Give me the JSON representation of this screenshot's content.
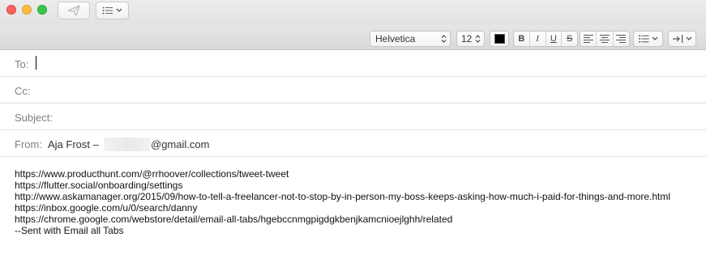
{
  "window": {
    "send_icon": "paper-plane-icon",
    "list_icon": "list-icon"
  },
  "format": {
    "font_name": "Helvetica",
    "font_size": "12",
    "text_color": "#000000",
    "bold": "B",
    "italic": "I",
    "underline": "U",
    "strikethrough": "S"
  },
  "header": {
    "to_label": "To:",
    "to_value": "",
    "cc_label": "Cc:",
    "subject_label": "Subject:",
    "from_label": "From:",
    "from_name": "Aja Frost –",
    "from_domain": "@gmail.com"
  },
  "body": {
    "lines": [
      "https://www.producthunt.com/@rrhoover/collections/tweet-tweet",
      "https://flutter.social/onboarding/settings",
      "http://www.askamanager.org/2015/09/how-to-tell-a-freelancer-not-to-stop-by-in-person-my-boss-keeps-asking-how-much-i-paid-for-things-and-more.html",
      "https://inbox.google.com/u/0/search/danny",
      "https://chrome.google.com/webstore/detail/email-all-tabs/hgebccnmgpigdgkbenjkamcnioejlghh/related",
      "--Sent with Email all Tabs"
    ]
  }
}
